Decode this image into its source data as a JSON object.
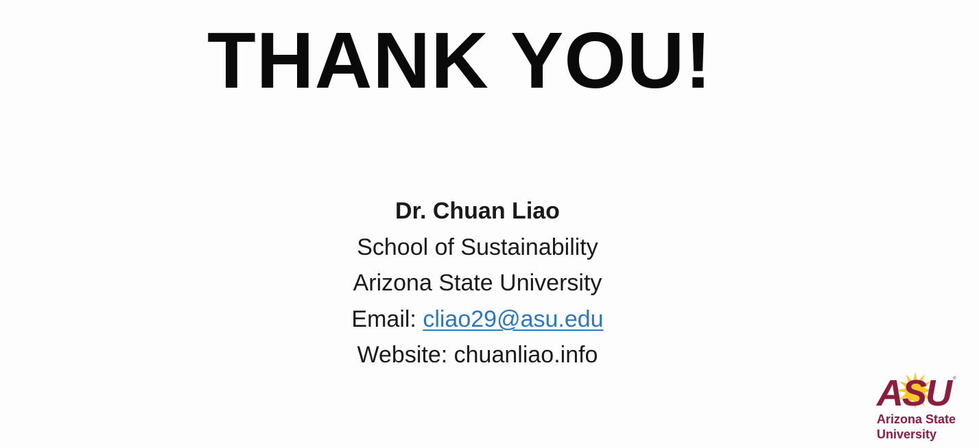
{
  "slide": {
    "title": "THANK YOU!",
    "contact": {
      "name": "Dr. Chuan Liao",
      "school": "School of Sustainability",
      "university": "Arizona State University",
      "email_label": "Email:",
      "email_value": "cliao29@asu.edu",
      "website_label": "Website:",
      "website_value": "chuanliao.info"
    }
  },
  "logo": {
    "wordmark": "ASU",
    "line1": "Arizona State",
    "line2": "University",
    "maroon_color": "#8c1d40",
    "gold_color": "#ffc627"
  }
}
